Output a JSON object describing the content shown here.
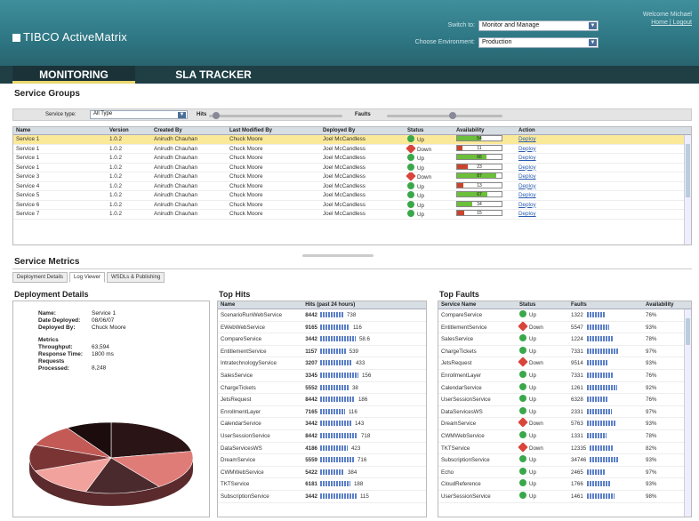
{
  "header": {
    "logo": "TIBCO ActiveMatrix",
    "switch_label": "Switch to:",
    "switch_value": "Monitor and Manage",
    "env_label": "Choose Environment:",
    "env_value": "Production",
    "welcome": "Welcome Michael",
    "logout": "Home | Logout"
  },
  "nav": {
    "tabs": [
      {
        "label": "MONITORING"
      },
      {
        "label": "SLA TRACKER"
      }
    ]
  },
  "service_groups": {
    "title": "Service Groups",
    "filter": {
      "type_label": "Service type:",
      "type_value": "All Type",
      "hits_label": "Hits",
      "faults_label": "Faults"
    },
    "columns": [
      "Name",
      "Version",
      "Created By",
      "Last Modified By",
      "Deployed By",
      "Status",
      "Availability",
      "Action"
    ],
    "rows": [
      {
        "name": "Service 1",
        "version": "1.0.2",
        "created": "Anirudh Chauhan",
        "modified": "Chuck Moore",
        "deployed": "Joel McCandless",
        "status": "Up",
        "avail_pct": "54",
        "action": "Deploy",
        "selected": true
      },
      {
        "name": "Service 1",
        "version": "1.0.2",
        "created": "Anirudh Chauhan",
        "modified": "Chuck Moore",
        "deployed": "Joel McCandless",
        "status": "Down",
        "avail_pct": "11",
        "action": "Deploy"
      },
      {
        "name": "Service 1",
        "version": "1.0.2",
        "created": "Anirudh Chauhan",
        "modified": "Chuck Moore",
        "deployed": "Joel McCandless",
        "status": "Up",
        "avail_pct": "66",
        "action": "Deploy"
      },
      {
        "name": "Service 1",
        "version": "1.0.2",
        "created": "Anirudh Chauhan",
        "modified": "Chuck Moore",
        "deployed": "Joel McCandless",
        "status": "Up",
        "avail_pct": "23",
        "action": "Deploy"
      },
      {
        "name": "Service 3",
        "version": "1.0.2",
        "created": "Anirudh Chauhan",
        "modified": "Chuck Moore",
        "deployed": "Joel McCandless",
        "status": "Down",
        "avail_pct": "87",
        "action": "Deploy"
      },
      {
        "name": "Service 4",
        "version": "1.0.2",
        "created": "Anirudh Chauhan",
        "modified": "Chuck Moore",
        "deployed": "Joel McCandless",
        "status": "Up",
        "avail_pct": "13",
        "action": "Deploy"
      },
      {
        "name": "Service 5",
        "version": "1.0.2",
        "created": "Anirudh Chauhan",
        "modified": "Chuck Moore",
        "deployed": "Joel McCandless",
        "status": "Up",
        "avail_pct": "67",
        "action": "Deploy"
      },
      {
        "name": "Service 6",
        "version": "1.0.2",
        "created": "Anirudh Chauhan",
        "modified": "Chuck Moore",
        "deployed": "Joel McCandless",
        "status": "Up",
        "avail_pct": "34",
        "action": "Deploy"
      },
      {
        "name": "Service 7",
        "version": "1.0.2",
        "created": "Anirudh Chauhan",
        "modified": "Chuck Moore",
        "deployed": "Joel McCandless",
        "status": "Up",
        "avail_pct": "15",
        "action": "Deploy"
      }
    ]
  },
  "service_metrics": {
    "title": "Service Metrics",
    "tabs": [
      "Deployment Details",
      "Log Viewer",
      "WSDLs & Publishing"
    ]
  },
  "deployment": {
    "title": "Deployment Details",
    "fields": [
      {
        "k": "Name:",
        "v": "Service 1"
      },
      {
        "k": "Date Deployed:",
        "v": "08/06/07"
      },
      {
        "k": "Deployed By:",
        "v": "Chuck Moore"
      }
    ],
    "metrics_label": "Metrics",
    "metrics": [
      {
        "k": "Throughput:",
        "v": "63,594"
      },
      {
        "k": "Response Time:",
        "v": "1800 ms"
      },
      {
        "k": "Requests Processed:",
        "v": "8,248"
      }
    ],
    "pie": [
      22,
      18,
      15,
      14,
      12,
      10,
      9
    ]
  },
  "top_hits": {
    "title": "Top Hits",
    "columns": [
      "Name",
      "Hits (past 24 hours)"
    ],
    "rows": [
      [
        "ScenarioRunWebService",
        "8442",
        "738"
      ],
      [
        "EWebWebService",
        "9165",
        "116"
      ],
      [
        "CompareService",
        "3442",
        "58.6"
      ],
      [
        "EntitlementService",
        "1157",
        "539"
      ],
      [
        "IntratechnologyService",
        "3207",
        "433"
      ],
      [
        "SalesService",
        "3345",
        "156"
      ],
      [
        "ChargeTickets",
        "5552",
        "38"
      ],
      [
        "JetsRequest",
        "8442",
        "186"
      ],
      [
        "EnrollmentLayer",
        "7165",
        "116"
      ],
      [
        "CalendarService",
        "3442",
        "143"
      ],
      [
        "UserSessionService",
        "8442",
        "718"
      ],
      [
        "DataServicesWS",
        "4186",
        "423"
      ],
      [
        "DreamService",
        "5559",
        "716"
      ],
      [
        "CWMWebService",
        "5422",
        "384"
      ],
      [
        "TKTService",
        "6181",
        "188"
      ],
      [
        "SubscriptionService",
        "3442",
        "115"
      ]
    ]
  },
  "top_faults": {
    "title": "Top Faults",
    "columns": [
      "Service Name",
      "Status",
      "Faults",
      "Availability"
    ],
    "rows": [
      [
        "CompareService",
        "Up",
        "1322",
        "76%"
      ],
      [
        "EntitlementService",
        "Down",
        "5547",
        "93%"
      ],
      [
        "SalesService",
        "Up",
        "1224",
        "78%"
      ],
      [
        "ChargeTickets",
        "Up",
        "7331",
        "97%"
      ],
      [
        "JetsRequest",
        "Down",
        "9514",
        "93%"
      ],
      [
        "EnrollmentLayer",
        "Up",
        "7331",
        "76%"
      ],
      [
        "CalendarService",
        "Up",
        "1261",
        "92%"
      ],
      [
        "UserSessionService",
        "Up",
        "6328",
        "76%"
      ],
      [
        "DataServicesWS",
        "Up",
        "2331",
        "97%"
      ],
      [
        "DreamService",
        "Down",
        "5763",
        "93%"
      ],
      [
        "CWMWebService",
        "Up",
        "1331",
        "78%"
      ],
      [
        "TKTService",
        "Down",
        "12335",
        "82%"
      ],
      [
        "SubscriptionService",
        "Up",
        "34746",
        "93%"
      ],
      [
        "Echo",
        "Up",
        "2465",
        "97%"
      ],
      [
        "CloudReference",
        "Up",
        "1766",
        "93%"
      ],
      [
        "UserSessionService",
        "Up",
        "1461",
        "98%"
      ]
    ]
  },
  "colors": {
    "header": "#2e7683",
    "nav": "#1f3f45",
    "accent": "#e9d66b",
    "up": "#3aa84a",
    "down": "#d9443b",
    "bar_good": "#6cbf3a",
    "bar_bad": "#c9442c"
  }
}
